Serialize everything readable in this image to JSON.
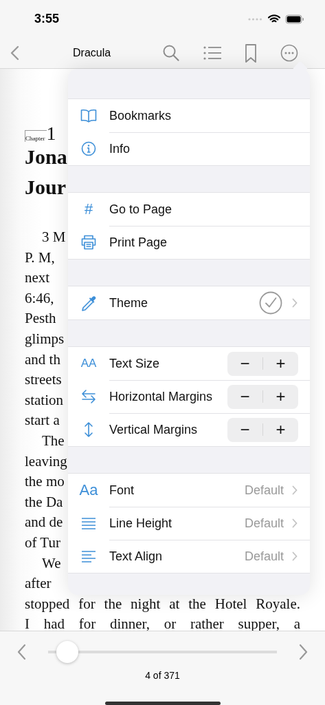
{
  "status_bar": {
    "time": "3:55"
  },
  "nav": {
    "title": "Dracula"
  },
  "page": {
    "chapter_label": "Chapter",
    "chapter_number": "1",
    "title_lines": [
      "Jona",
      "Jour"
    ],
    "body_lines": [
      {
        "text": "3 M",
        "paragraph_start": true
      },
      {
        "text": "P. M,",
        "paragraph_start": false
      },
      {
        "text": "next",
        "paragraph_start": false
      },
      {
        "text": "6:46,",
        "paragraph_start": false
      },
      {
        "text": "Pesth",
        "paragraph_start": false
      },
      {
        "text": "glimps",
        "paragraph_start": false
      },
      {
        "text": "and th",
        "paragraph_start": false
      },
      {
        "text": "streets",
        "paragraph_start": false
      },
      {
        "text": "station",
        "paragraph_start": false
      },
      {
        "text": "start a",
        "paragraph_start": false
      },
      {
        "text": "The",
        "paragraph_start": true
      },
      {
        "text": "leaving",
        "paragraph_start": false
      },
      {
        "text": "the mo",
        "paragraph_start": false
      },
      {
        "text": "the Da",
        "paragraph_start": false
      },
      {
        "text": "and de",
        "paragraph_start": false
      },
      {
        "text": "of Tur",
        "paragraph_start": false
      },
      {
        "text": "We",
        "paragraph_start": true
      },
      {
        "text": "after",
        "paragraph_start": false
      }
    ],
    "full_lines": [
      "stopped for the night at the Hotel Royale.",
      "I had for dinner, or rather supper, a"
    ]
  },
  "menu": {
    "sections": [
      {
        "items": [
          {
            "kind": "plain",
            "label": "Bookmarks"
          },
          {
            "kind": "plain",
            "label": "Info"
          }
        ]
      },
      {
        "items": [
          {
            "kind": "plain",
            "label": "Go to Page",
            "glyph": "#"
          },
          {
            "kind": "plain",
            "label": "Print Page"
          }
        ]
      },
      {
        "items": [
          {
            "kind": "theme",
            "label": "Theme",
            "checked": true
          }
        ]
      },
      {
        "items": [
          {
            "kind": "stepper",
            "label": "Text Size",
            "glyph": "AA",
            "minus": "−",
            "plus": "+"
          },
          {
            "kind": "stepper",
            "label": "Horizontal Margins",
            "minus": "−",
            "plus": "+"
          },
          {
            "kind": "stepper",
            "label": "Vertical Margins",
            "minus": "−",
            "plus": "+"
          }
        ]
      },
      {
        "items": [
          {
            "kind": "value",
            "label": "Font",
            "glyph": "Aa",
            "value": "Default"
          },
          {
            "kind": "value",
            "label": "Line Height",
            "value": "Default"
          },
          {
            "kind": "value",
            "label": "Text Align",
            "value": "Default"
          }
        ]
      }
    ]
  },
  "footer": {
    "level": 0.04,
    "page": "4 of 371"
  }
}
